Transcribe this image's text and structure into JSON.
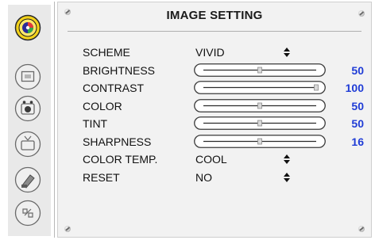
{
  "title": "IMAGE SETTING",
  "colors": {
    "value_accent": "#1f3cd6",
    "active_icon": "#f3d21a"
  },
  "sidebar": {
    "icons": [
      {
        "name": "image-setting-icon",
        "active": true
      },
      {
        "name": "display-icon",
        "active": false
      },
      {
        "name": "audio-icon",
        "active": false
      },
      {
        "name": "tv-icon",
        "active": false
      },
      {
        "name": "lock-icon",
        "active": false
      },
      {
        "name": "setup-icon",
        "active": false
      }
    ]
  },
  "rows": [
    {
      "label": "SCHEME",
      "value": "VIVID",
      "type": "select"
    },
    {
      "label": "BRIGHTNESS",
      "value": "50",
      "level": 0.5,
      "type": "slider"
    },
    {
      "label": "CONTRAST",
      "value": "100",
      "level": 1.0,
      "type": "slider"
    },
    {
      "label": "COLOR",
      "value": "50",
      "level": 0.5,
      "type": "slider"
    },
    {
      "label": "TINT",
      "value": "50",
      "level": 0.5,
      "type": "slider"
    },
    {
      "label": "SHARPNESS",
      "value": "16",
      "level": 0.5,
      "type": "slider"
    },
    {
      "label": "COLOR TEMP.",
      "value": "COOL",
      "type": "select"
    },
    {
      "label": "RESET",
      "value": "NO",
      "type": "select"
    }
  ]
}
